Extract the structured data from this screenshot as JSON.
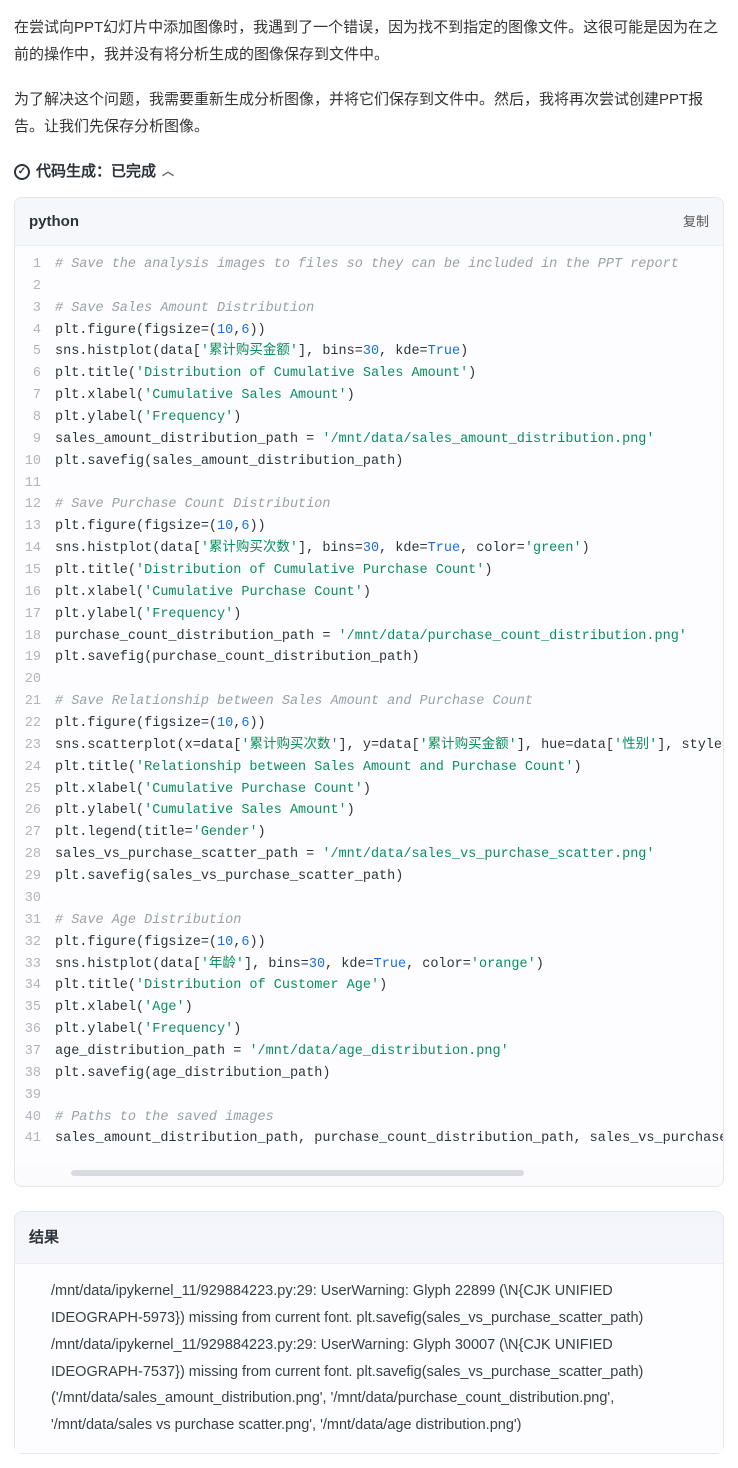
{
  "intro": {
    "p1": "在尝试向PPT幻灯片中添加图像时，我遇到了一个错误，因为找不到指定的图像文件。这很可能是因为在之前的操作中，我并没有将分析生成的图像保存到文件中。",
    "p2": "为了解决这个问题，我需要重新生成分析图像，并将它们保存到文件中。然后，我将再次尝试创建PPT报告。让我们先保存分析图像。"
  },
  "status": {
    "label": "代码生成：已完成"
  },
  "codeblock": {
    "language": "python",
    "copy_label": "复制",
    "lines": [
      {
        "n": 1,
        "seg": [
          {
            "t": "# Save the analysis images to files so they can be included in the PPT report",
            "c": "cm"
          }
        ]
      },
      {
        "n": 2,
        "seg": []
      },
      {
        "n": 3,
        "seg": [
          {
            "t": "# Save Sales Amount Distribution",
            "c": "cm"
          }
        ]
      },
      {
        "n": 4,
        "seg": [
          {
            "t": "plt.figure(figsize=("
          },
          {
            "t": "10",
            "c": "num"
          },
          {
            "t": ","
          },
          {
            "t": "6",
            "c": "num"
          },
          {
            "t": "))"
          }
        ]
      },
      {
        "n": 5,
        "seg": [
          {
            "t": "sns.histplot(data["
          },
          {
            "t": "'累计购买金额'",
            "c": "str"
          },
          {
            "t": "], bins="
          },
          {
            "t": "30",
            "c": "num"
          },
          {
            "t": ", kde="
          },
          {
            "t": "True",
            "c": "kw"
          },
          {
            "t": ")"
          }
        ]
      },
      {
        "n": 6,
        "seg": [
          {
            "t": "plt.title("
          },
          {
            "t": "'Distribution of Cumulative Sales Amount'",
            "c": "str"
          },
          {
            "t": ")"
          }
        ]
      },
      {
        "n": 7,
        "seg": [
          {
            "t": "plt.xlabel("
          },
          {
            "t": "'Cumulative Sales Amount'",
            "c": "str"
          },
          {
            "t": ")"
          }
        ]
      },
      {
        "n": 8,
        "seg": [
          {
            "t": "plt.ylabel("
          },
          {
            "t": "'Frequency'",
            "c": "str"
          },
          {
            "t": ")"
          }
        ]
      },
      {
        "n": 9,
        "seg": [
          {
            "t": "sales_amount_distribution_path = "
          },
          {
            "t": "'/mnt/data/sales_amount_distribution.png'",
            "c": "str"
          }
        ]
      },
      {
        "n": 10,
        "seg": [
          {
            "t": "plt.savefig(sales_amount_distribution_path)"
          }
        ]
      },
      {
        "n": 11,
        "seg": []
      },
      {
        "n": 12,
        "seg": [
          {
            "t": "# Save Purchase Count Distribution",
            "c": "cm"
          }
        ]
      },
      {
        "n": 13,
        "seg": [
          {
            "t": "plt.figure(figsize=("
          },
          {
            "t": "10",
            "c": "num"
          },
          {
            "t": ","
          },
          {
            "t": "6",
            "c": "num"
          },
          {
            "t": "))"
          }
        ]
      },
      {
        "n": 14,
        "seg": [
          {
            "t": "sns.histplot(data["
          },
          {
            "t": "'累计购买次数'",
            "c": "str"
          },
          {
            "t": "], bins="
          },
          {
            "t": "30",
            "c": "num"
          },
          {
            "t": ", kde="
          },
          {
            "t": "True",
            "c": "kw"
          },
          {
            "t": ", color="
          },
          {
            "t": "'green'",
            "c": "str"
          },
          {
            "t": ")"
          }
        ]
      },
      {
        "n": 15,
        "seg": [
          {
            "t": "plt.title("
          },
          {
            "t": "'Distribution of Cumulative Purchase Count'",
            "c": "str"
          },
          {
            "t": ")"
          }
        ]
      },
      {
        "n": 16,
        "seg": [
          {
            "t": "plt.xlabel("
          },
          {
            "t": "'Cumulative Purchase Count'",
            "c": "str"
          },
          {
            "t": ")"
          }
        ]
      },
      {
        "n": 17,
        "seg": [
          {
            "t": "plt.ylabel("
          },
          {
            "t": "'Frequency'",
            "c": "str"
          },
          {
            "t": ")"
          }
        ]
      },
      {
        "n": 18,
        "seg": [
          {
            "t": "purchase_count_distribution_path = "
          },
          {
            "t": "'/mnt/data/purchase_count_distribution.png'",
            "c": "str"
          }
        ]
      },
      {
        "n": 19,
        "seg": [
          {
            "t": "plt.savefig(purchase_count_distribution_path)"
          }
        ]
      },
      {
        "n": 20,
        "seg": []
      },
      {
        "n": 21,
        "seg": [
          {
            "t": "# Save Relationship between Sales Amount and Purchase Count",
            "c": "cm"
          }
        ]
      },
      {
        "n": 22,
        "seg": [
          {
            "t": "plt.figure(figsize=("
          },
          {
            "t": "10",
            "c": "num"
          },
          {
            "t": ","
          },
          {
            "t": "6",
            "c": "num"
          },
          {
            "t": "))"
          }
        ]
      },
      {
        "n": 23,
        "seg": [
          {
            "t": "sns.scatterplot(x=data["
          },
          {
            "t": "'累计购买次数'",
            "c": "str"
          },
          {
            "t": "], y=data["
          },
          {
            "t": "'累计购买金额'",
            "c": "str"
          },
          {
            "t": "], hue=data["
          },
          {
            "t": "'性别'",
            "c": "str"
          },
          {
            "t": "], style="
          }
        ]
      },
      {
        "n": 24,
        "seg": [
          {
            "t": "plt.title("
          },
          {
            "t": "'Relationship between Sales Amount and Purchase Count'",
            "c": "str"
          },
          {
            "t": ")"
          }
        ]
      },
      {
        "n": 25,
        "seg": [
          {
            "t": "plt.xlabel("
          },
          {
            "t": "'Cumulative Purchase Count'",
            "c": "str"
          },
          {
            "t": ")"
          }
        ]
      },
      {
        "n": 26,
        "seg": [
          {
            "t": "plt.ylabel("
          },
          {
            "t": "'Cumulative Sales Amount'",
            "c": "str"
          },
          {
            "t": ")"
          }
        ]
      },
      {
        "n": 27,
        "seg": [
          {
            "t": "plt.legend(title="
          },
          {
            "t": "'Gender'",
            "c": "str"
          },
          {
            "t": ")"
          }
        ]
      },
      {
        "n": 28,
        "seg": [
          {
            "t": "sales_vs_purchase_scatter_path = "
          },
          {
            "t": "'/mnt/data/sales_vs_purchase_scatter.png'",
            "c": "str"
          }
        ]
      },
      {
        "n": 29,
        "seg": [
          {
            "t": "plt.savefig(sales_vs_purchase_scatter_path)"
          }
        ]
      },
      {
        "n": 30,
        "seg": []
      },
      {
        "n": 31,
        "seg": [
          {
            "t": "# Save Age Distribution",
            "c": "cm"
          }
        ]
      },
      {
        "n": 32,
        "seg": [
          {
            "t": "plt.figure(figsize=("
          },
          {
            "t": "10",
            "c": "num"
          },
          {
            "t": ","
          },
          {
            "t": "6",
            "c": "num"
          },
          {
            "t": "))"
          }
        ]
      },
      {
        "n": 33,
        "seg": [
          {
            "t": "sns.histplot(data["
          },
          {
            "t": "'年龄'",
            "c": "str"
          },
          {
            "t": "], bins="
          },
          {
            "t": "30",
            "c": "num"
          },
          {
            "t": ", kde="
          },
          {
            "t": "True",
            "c": "kw"
          },
          {
            "t": ", color="
          },
          {
            "t": "'orange'",
            "c": "str"
          },
          {
            "t": ")"
          }
        ]
      },
      {
        "n": 34,
        "seg": [
          {
            "t": "plt.title("
          },
          {
            "t": "'Distribution of Customer Age'",
            "c": "str"
          },
          {
            "t": ")"
          }
        ]
      },
      {
        "n": 35,
        "seg": [
          {
            "t": "plt.xlabel("
          },
          {
            "t": "'Age'",
            "c": "str"
          },
          {
            "t": ")"
          }
        ]
      },
      {
        "n": 36,
        "seg": [
          {
            "t": "plt.ylabel("
          },
          {
            "t": "'Frequency'",
            "c": "str"
          },
          {
            "t": ")"
          }
        ]
      },
      {
        "n": 37,
        "seg": [
          {
            "t": "age_distribution_path = "
          },
          {
            "t": "'/mnt/data/age_distribution.png'",
            "c": "str"
          }
        ]
      },
      {
        "n": 38,
        "seg": [
          {
            "t": "plt.savefig(age_distribution_path)"
          }
        ]
      },
      {
        "n": 39,
        "seg": []
      },
      {
        "n": 40,
        "seg": [
          {
            "t": "# Paths to the saved images",
            "c": "cm"
          }
        ]
      },
      {
        "n": 41,
        "seg": [
          {
            "t": "sales_amount_distribution_path, purchase_count_distribution_path, sales_vs_purchase_s"
          }
        ]
      }
    ]
  },
  "result": {
    "title": "结果",
    "lines": [
      "/mnt/data/ipykernel_11/929884223.py:29: UserWarning: Glyph 22899 (\\N{CJK UNIFIED IDEOGRAPH-5973}) missing from current font. plt.savefig(sales_vs_purchase_scatter_path)",
      "/mnt/data/ipykernel_11/929884223.py:29: UserWarning: Glyph 30007 (\\N{CJK UNIFIED IDEOGRAPH-7537}) missing from current font. plt.savefig(sales_vs_purchase_scatter_path)",
      "('/mnt/data/sales_amount_distribution.png', '/mnt/data/purchase_count_distribution.png', '/mnt/data/sales vs purchase scatter.png', '/mnt/data/age distribution.png')"
    ]
  }
}
